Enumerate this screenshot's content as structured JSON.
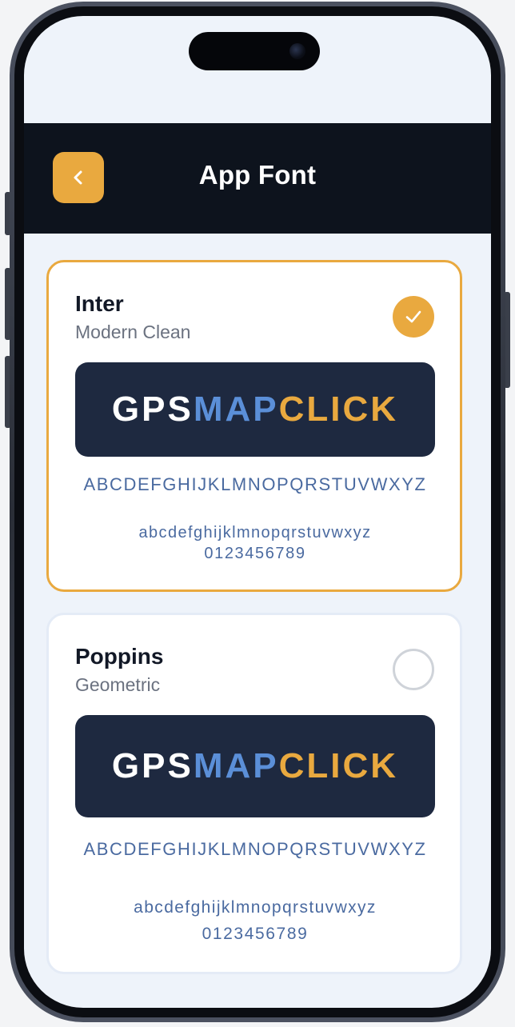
{
  "header": {
    "title": "App Font",
    "back_icon": "chevron-left-icon"
  },
  "colors": {
    "accent": "#e9a93f",
    "header_bg": "#0d131d",
    "preview_bg": "#1e2940",
    "preview_blue": "#5b8fd8",
    "charset_text": "#4a6aa0"
  },
  "fonts": [
    {
      "name": "Inter",
      "style": "Modern Clean",
      "selected": true,
      "preview": {
        "part1": "GPS",
        "part2": "MAP",
        "part3": "CLICK"
      },
      "uppercase": "ABCDEFGHIJKLMNOPQRSTUVWXYZ",
      "lowercase": "abcdefghijklmnopqrstuvwxyz",
      "digits": "0123456789"
    },
    {
      "name": "Poppins",
      "style": "Geometric",
      "selected": false,
      "preview": {
        "part1": "GPS",
        "part2": "MAP",
        "part3": "CLICK"
      },
      "uppercase": "ABCDEFGHIJKLMNOPQRSTUVWXYZ",
      "lowercase": "abcdefghijklmnopqrstuvwxyz",
      "digits": "0123456789"
    }
  ]
}
